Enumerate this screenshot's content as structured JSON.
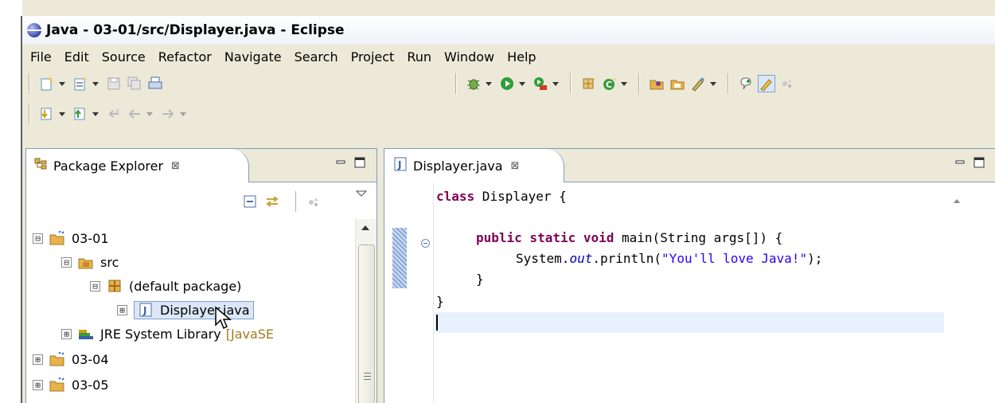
{
  "window": {
    "title": "Java - 03-01/src/Displayer.java - Eclipse"
  },
  "menu": [
    "File",
    "Edit",
    "Source",
    "Refactor",
    "Navigate",
    "Search",
    "Project",
    "Run",
    "Window",
    "Help"
  ],
  "toolbar": {
    "row1_left": [
      "new-wizard-icon",
      "new-java-file-icon",
      "save-icon",
      "save-all-icon",
      "print-icon"
    ],
    "row1_right": [
      "debug-icon",
      "run-icon",
      "external-tools-icon",
      "new-java-project-icon",
      "new-class-icon",
      "open-type-icon",
      "search-icon",
      "annotation-icon",
      "toggle-markers-icon",
      "pen-icon",
      "spinner-icon"
    ],
    "row2": [
      "next-annotation-icon",
      "previous-annotation-icon",
      "last-edit-location-icon",
      "back-icon",
      "forward-icon"
    ]
  },
  "package_explorer": {
    "tab_label": "Package Explorer",
    "close_symbol": "⊠",
    "tree": [
      {
        "label": "03-01",
        "expander": "⊟",
        "icon": "java-project-icon"
      },
      {
        "label": "src",
        "expander": "⊟",
        "icon": "source-folder-icon"
      },
      {
        "label": "(default package)",
        "expander": "⊟",
        "icon": "package-icon"
      },
      {
        "label": "Displayer.java",
        "expander": "⊞",
        "icon": "java-file-icon",
        "selected": true
      },
      {
        "label": "JRE System Library",
        "decoration": "[JavaSE",
        "expander": "⊞",
        "icon": "library-icon"
      },
      {
        "label": "03-04",
        "expander": "⊞",
        "icon": "java-project-icon"
      },
      {
        "label": "03-05",
        "expander": "⊞",
        "icon": "java-project-icon"
      }
    ]
  },
  "editor": {
    "tab_label": "Displayer.java",
    "close_symbol": "⊠",
    "code": {
      "line1_kw": "class",
      "line1_rest": " Displayer {",
      "line3_kw": "public static void",
      "line3_rest": " main(String args[]) {",
      "line4_pre": "System.",
      "line4_field": "out",
      "line4_mid": ".println(",
      "line4_str": "\"You'll love Java!\"",
      "line4_end": ");",
      "line5": "}",
      "line6": "}"
    }
  },
  "colors": {
    "accent": "#7f9db9",
    "keyword": "#7f0055",
    "string": "#2a00ff",
    "field": "#0000c0",
    "current_line": "#e8f2fe"
  }
}
